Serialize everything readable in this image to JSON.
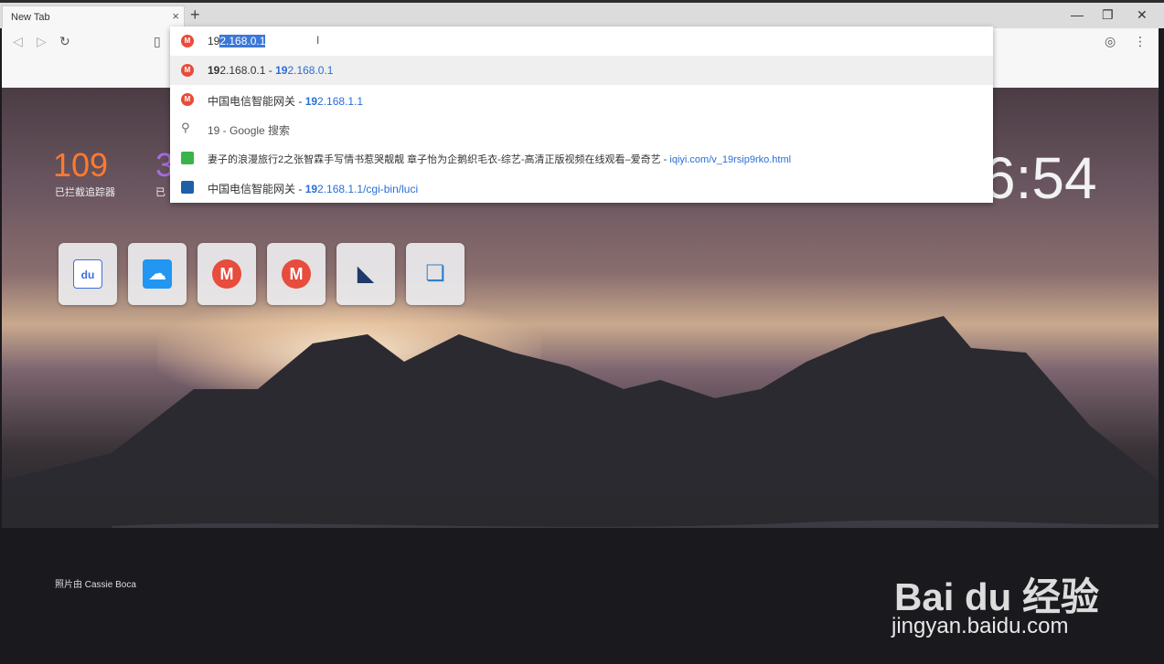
{
  "tab": {
    "title": "New Tab",
    "close": "×",
    "new_tab": "+"
  },
  "window": {
    "minimize": "—",
    "restore": "❐",
    "close": "✕"
  },
  "toolbar": {
    "back": "◁",
    "forward": "▷",
    "reload": "↻",
    "bookmark": "▯",
    "account": "◎",
    "menu": "⋮"
  },
  "omnibox": {
    "typed": "19",
    "selected": "2.168.0.1",
    "caret": "I",
    "suggestions": [
      {
        "icon": "m-logo-icon",
        "bold": "19",
        "text": "2.168.0.1",
        "sep": " - ",
        "url_bold": "19",
        "url": "2.168.0.1"
      },
      {
        "icon": "m-logo-icon",
        "bold": "",
        "text": "中国电信智能网关",
        "sep": " - ",
        "url_bold": "19",
        "url": "2.168.1.1"
      },
      {
        "icon": "search-icon",
        "bold": "",
        "text": "19 - Google 搜索",
        "sep": "",
        "url_bold": "",
        "url": ""
      },
      {
        "icon": "iqiyi-icon",
        "bold": "",
        "text": "妻子的浪漫旅行2之张智霖手写情书惹哭靓靓 章子怡为企鹅织毛衣-综艺-高清正版视频在线观看–爱奇艺",
        "sep": " - ",
        "url_bold": "",
        "url": "iqiyi.com/v_19rsip9rko.html"
      },
      {
        "icon": "router-icon",
        "bold": "",
        "text": "中国电信智能网关",
        "sep": " - ",
        "url_bold": "19",
        "url": "2.168.1.1/cgi-bin/luci"
      }
    ]
  },
  "stats": [
    {
      "value": "109",
      "label": "已拦截追踪器"
    },
    {
      "value": "3",
      "label": "已"
    }
  ],
  "clock": "6:54",
  "shortcuts": [
    {
      "name": "baidu",
      "label": "du",
      "color": "#3b6fe0"
    },
    {
      "name": "baidu-cloud",
      "label": "☁",
      "color": "#2196f3"
    },
    {
      "name": "m-app-1",
      "label": "M",
      "color": "#e74c3c"
    },
    {
      "name": "m-app-2",
      "label": "M",
      "color": "#e74c3c"
    },
    {
      "name": "dark-blue-app",
      "label": "◣",
      "color": "#1f3a68"
    },
    {
      "name": "green-blue-app",
      "label": "❏",
      "color": "#2e7fc6"
    }
  ],
  "credit": "照片由 Cassie Boca",
  "watermark": {
    "brand": "Bai du 经验",
    "url": "jingyan.baidu.com"
  }
}
